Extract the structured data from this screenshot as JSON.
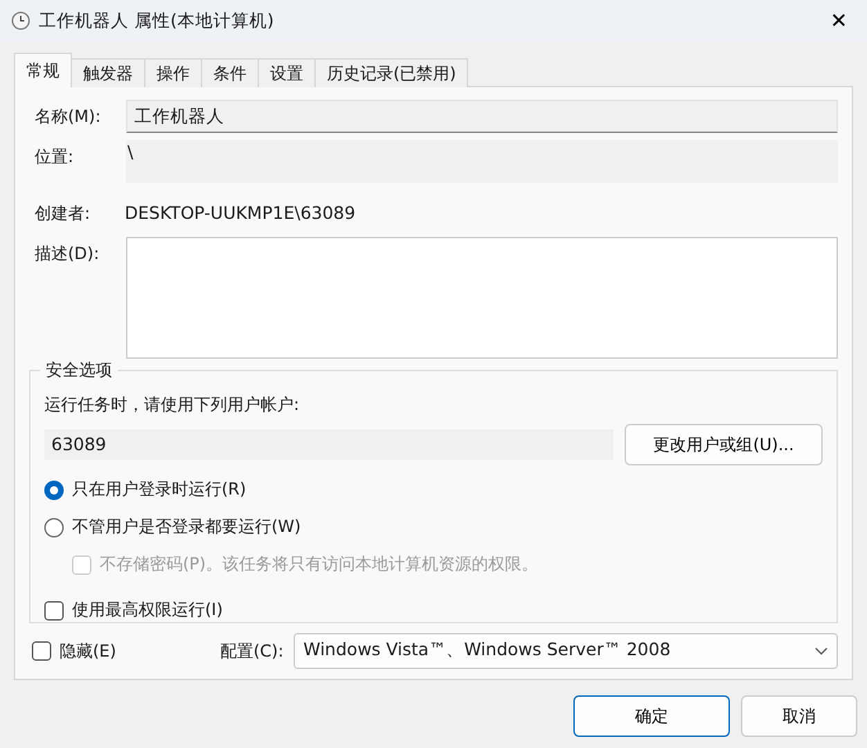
{
  "window": {
    "title": "工作机器人 属性(本地计算机)",
    "close": "✕"
  },
  "tabs": [
    {
      "label": "常规",
      "selected": true
    },
    {
      "label": "触发器",
      "selected": false
    },
    {
      "label": "操作",
      "selected": false
    },
    {
      "label": "条件",
      "selected": false
    },
    {
      "label": "设置",
      "selected": false
    },
    {
      "label": "历史记录(已禁用)",
      "selected": false
    }
  ],
  "fields": [
    {
      "kind": "name",
      "label": "名称(M):",
      "value": "工作机器人"
    },
    {
      "kind": "location",
      "label": "位置:",
      "value": "\\"
    },
    {
      "kind": "text",
      "label": "创建者:",
      "value": "DESKTOP-UUKMP1E\\63089"
    },
    {
      "kind": "description",
      "label": "描述(D):"
    }
  ],
  "security": {
    "title": "安全选项",
    "prompt": "运行任务时，请使用下列用户帐户:",
    "account": "63089",
    "change_button": "更改用户或组(U)...",
    "options": [
      {
        "kind": "radio",
        "label": "只在用户登录时运行(R)",
        "selected": true,
        "disabled": false
      },
      {
        "kind": "radio",
        "label": "不管用户是否登录都要运行(W)",
        "selected": false,
        "disabled": false
      },
      {
        "kind": "checkbox",
        "label": "不存储密码(P)。该任务将只有访问本地计算机资源的权限。",
        "checked": false,
        "disabled": true,
        "indent": true
      },
      {
        "kind": "checkbox",
        "label": "使用最高权限运行(I)",
        "checked": false,
        "disabled": false
      }
    ]
  },
  "hidden": {
    "label": "隐藏(E)",
    "checked": false
  },
  "config": {
    "label": "配置(C):",
    "value": "Windows Vista™、Windows Server™ 2008"
  },
  "buttons": [
    {
      "label": "确定",
      "default": true
    },
    {
      "label": "取消",
      "default": false
    }
  ]
}
